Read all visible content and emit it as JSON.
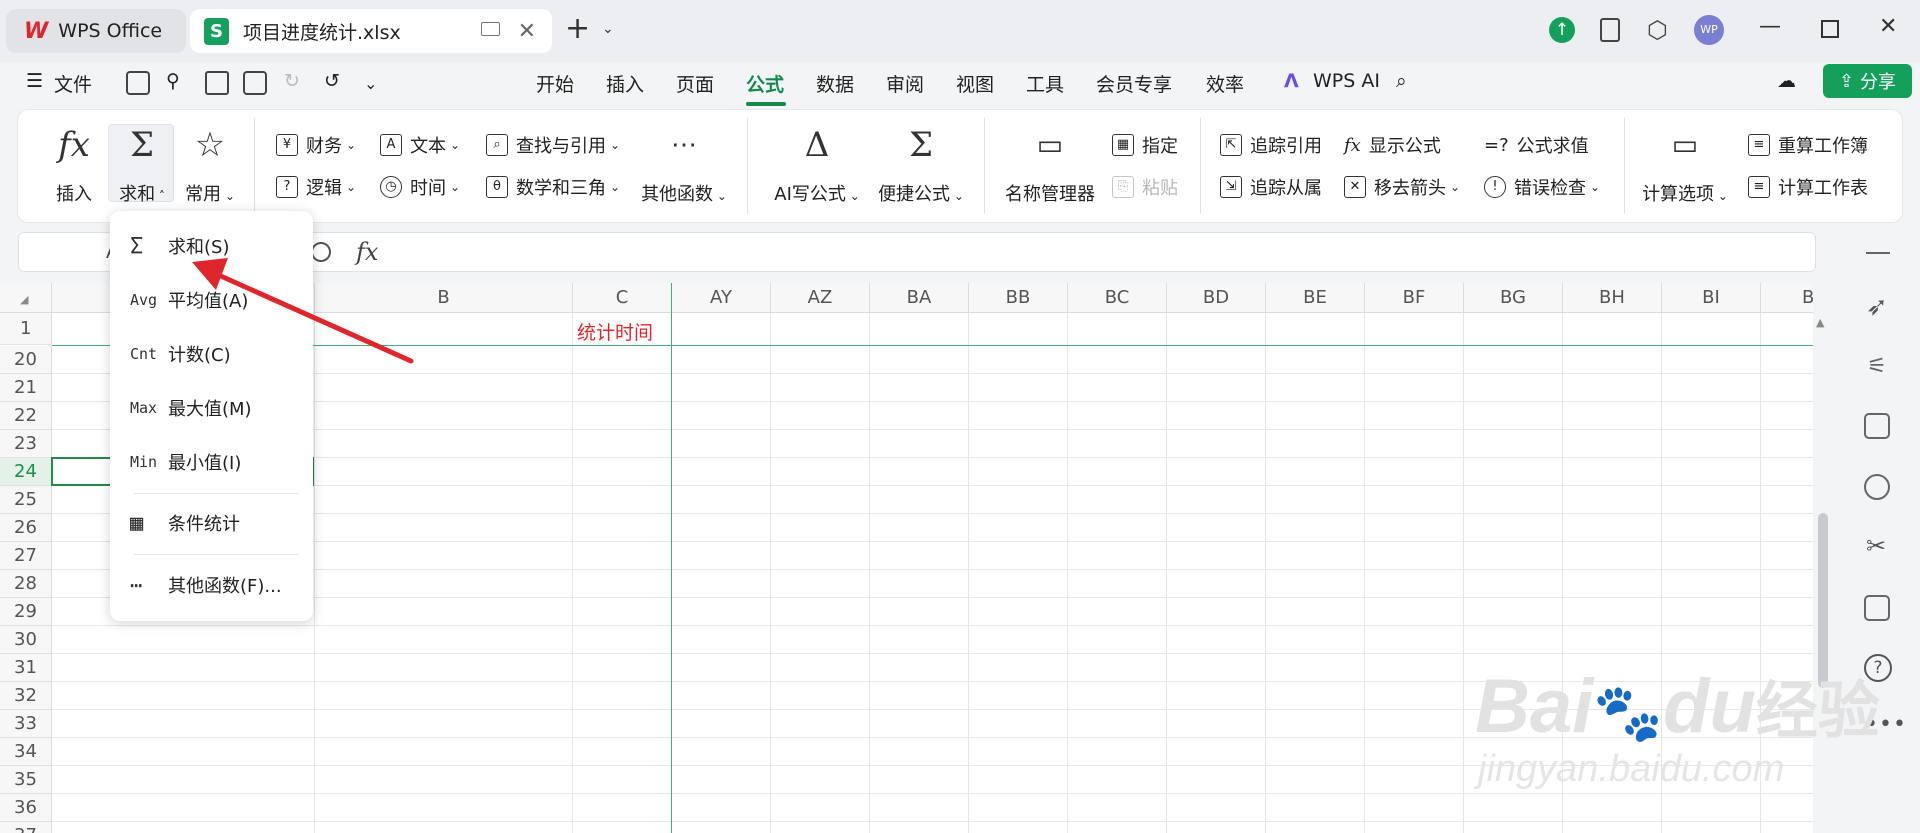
{
  "tabs": {
    "home_label": "WPS Office",
    "file_label": "项目进度统计.xlsx",
    "file_icon_letter": "S"
  },
  "menubar": {
    "file_label": "文件",
    "items": [
      "开始",
      "插入",
      "页面",
      "公式",
      "数据",
      "审阅",
      "视图",
      "工具",
      "会员专享",
      "效率"
    ],
    "active": "公式",
    "wps_ai_label": "WPS AI",
    "share_label": "分享",
    "avatar_text": "WP"
  },
  "ribbon": {
    "insert_label": "插入",
    "sum_label": "求和",
    "common_label": "常用",
    "finance_label": "财务",
    "logic_label": "逻辑",
    "text_label": "文本",
    "time_label": "时间",
    "lookup_label": "查找与引用",
    "math_label": "数学和三角",
    "other_functions_label": "其他函数",
    "ai_formula_label": "AI写公式",
    "quick_formula_label": "便捷公式",
    "name_manager_label": "名称管理器",
    "assign_label": "指定",
    "paste_label": "粘贴",
    "trace_precedents_label": "追踪引用",
    "trace_dependents_label": "追踪从属",
    "show_formulas_label": "显示公式",
    "remove_arrows_label": "移去箭头",
    "evaluate_label": "公式求值",
    "error_check_label": "错误检查",
    "calc_options_label": "计算选项",
    "recalc_workbook_label": "重算工作簿",
    "calc_sheet_label": "计算工作表"
  },
  "formula_bar": {
    "fx": "fx",
    "partial_ref": "A"
  },
  "grid": {
    "columns": [
      "B",
      "C",
      "AY",
      "AZ",
      "BA",
      "BB",
      "BC",
      "BD",
      "BE",
      "BF",
      "BG",
      "BH",
      "BI",
      "B"
    ],
    "frozen_row": "1",
    "rows": [
      "20",
      "21",
      "22",
      "23",
      "24",
      "25",
      "26",
      "27",
      "28",
      "29",
      "30",
      "31",
      "32",
      "33",
      "34",
      "35",
      "36",
      "37"
    ],
    "c1_text": "统计时间",
    "selected_row": "24"
  },
  "dropdown": {
    "items": [
      {
        "icon": "Σ",
        "label": "求和(S)"
      },
      {
        "icon": "Avg",
        "label": "平均值(A)"
      },
      {
        "icon": "Cnt",
        "label": "计数(C)"
      },
      {
        "icon": "Max",
        "label": "最大值(M)"
      },
      {
        "icon": "Min",
        "label": "最小值(I)"
      },
      {
        "icon": "▦",
        "label": "条件统计"
      },
      {
        "icon": "⋯",
        "label": "其他函数(F)..."
      }
    ]
  },
  "watermark": {
    "brand": "Bai",
    "paw_suffix": "du",
    "cn": "经验",
    "url": "jingyan.baidu.com"
  },
  "colors": {
    "accent_green": "#14894e",
    "annotation_red": "#e0262d"
  }
}
